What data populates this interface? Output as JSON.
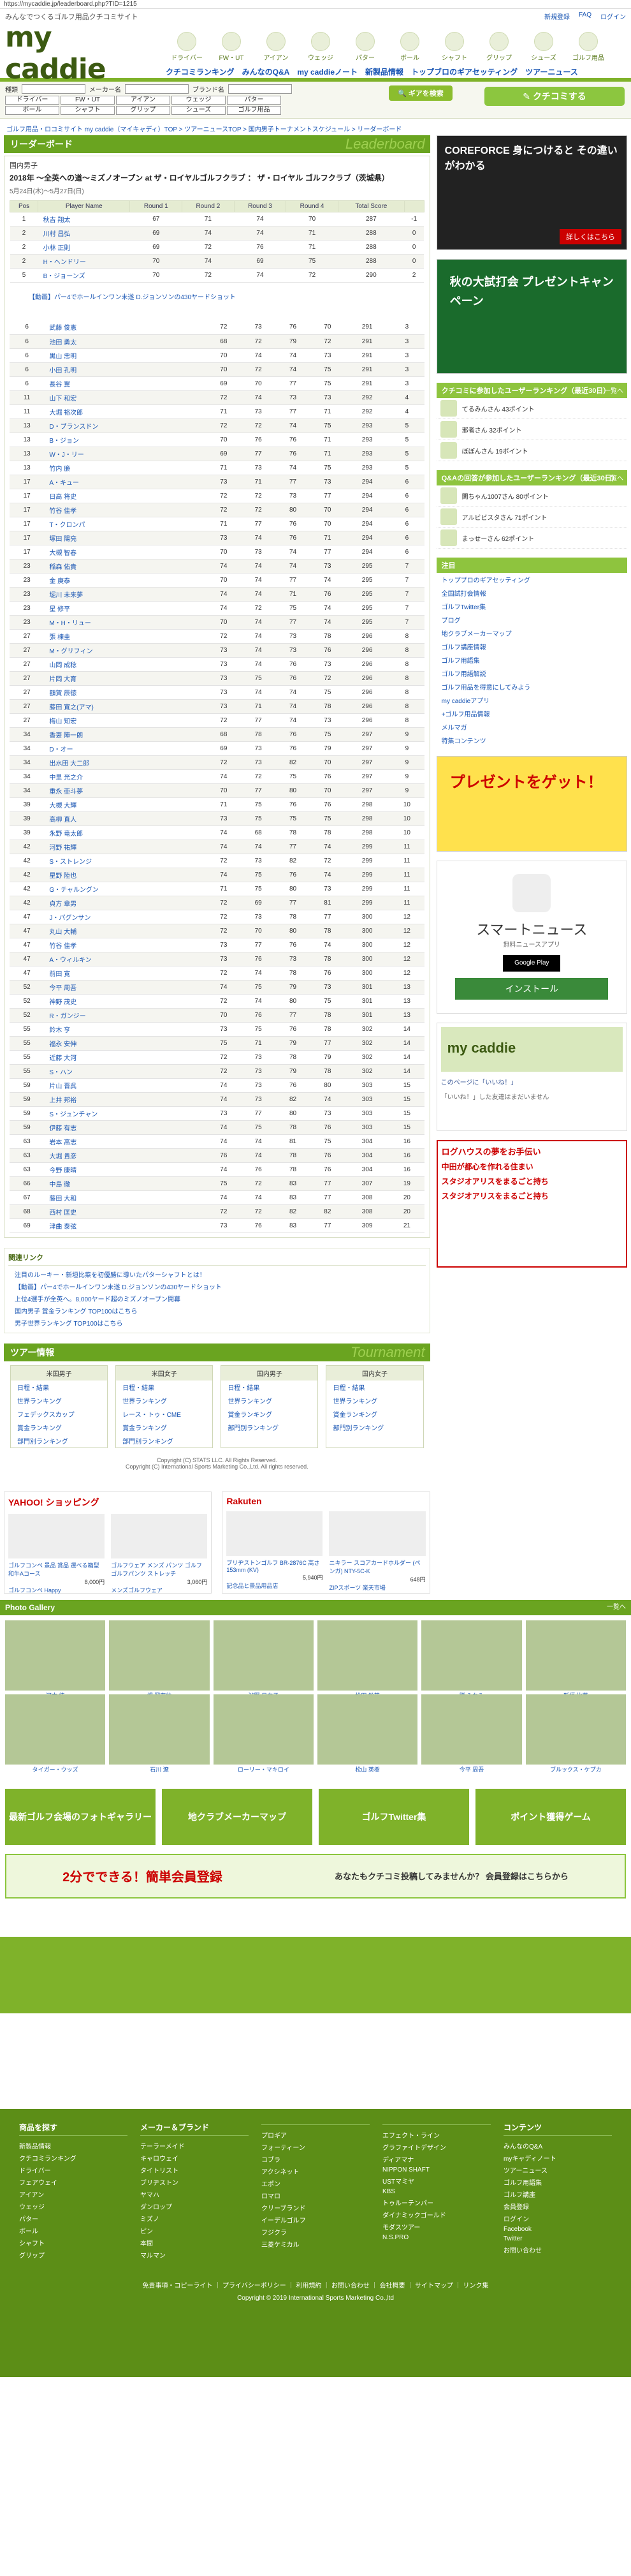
{
  "url": "https://mycaddie.jp/leaderboard.php?TID=1215",
  "header": {
    "tagline": "みんなでつくるゴルフ用品クチコミサイト",
    "logo": "my caddie",
    "toplinks": [
      "新規登録",
      "FAQ",
      "ログイン"
    ],
    "categories": [
      "ドライバー",
      "FW・UT",
      "アイアン",
      "ウェッジ",
      "パター",
      "ボール",
      "シャフト",
      "グリップ",
      "シューズ",
      "ゴルフ用品"
    ],
    "nav": [
      "クチコミランキング",
      "みんなのQ&A",
      "my caddieノート",
      "新製品情報",
      "トップブロのギアセッティング",
      "ツアーニュース"
    ]
  },
  "search": {
    "label_kind": "種類",
    "label_maker": "メーカー名",
    "label_brand": "ブランド名",
    "buttons": [
      "ドライバー",
      "FW・UT",
      "アイアン",
      "ウェッジ",
      "パター",
      "ボール",
      "シャフト",
      "グリップ",
      "シューズ",
      "ゴルフ用品"
    ],
    "gear_button": "ギアを検索",
    "kuchikomi": "クチコミする"
  },
  "breadcrumb": "ゴルフ用品・ロコミサイト my caddie（マイキャディ）TOP > ツアーニュースTOP > 国内男子トーナメントスケジュール > リーダーボード",
  "leaderboard": {
    "title": "リーダーボード",
    "title_en": "Leaderboard",
    "tour": "国内男子",
    "event": "2018年 ～全英への道～ミズノオープン at ザ・ロイヤルゴルフクラブ ： ザ・ロイヤル ゴルフクラブ（茨城県）",
    "date": "5月24日(木)～5月27日(日)",
    "columns": [
      "Pos",
      "Player Name",
      "Round 1",
      "Round 2",
      "Round 3",
      "Round 4",
      "Total Score",
      ""
    ],
    "top_rows": [
      [
        "1",
        "秋吉 翔太",
        "67",
        "71",
        "74",
        "70",
        "287",
        "-1"
      ],
      [
        "2",
        "川村 昌弘",
        "69",
        "74",
        "74",
        "71",
        "288",
        "0"
      ],
      [
        "2",
        "小林 正則",
        "69",
        "72",
        "76",
        "71",
        "288",
        "0"
      ],
      [
        "2",
        "H・ヘンドリー",
        "70",
        "74",
        "69",
        "75",
        "288",
        "0"
      ],
      [
        "5",
        "B・ジョーンズ",
        "70",
        "72",
        "74",
        "72",
        "290",
        "2"
      ]
    ],
    "note": "【動画】パー4でホールインワン未遂 D.ジョンソンの430ヤードショット",
    "rows": [
      [
        "6",
        "武藤 俊憲",
        "72",
        "73",
        "76",
        "70",
        "291",
        "3"
      ],
      [
        "6",
        "池田 勇太",
        "68",
        "72",
        "79",
        "72",
        "291",
        "3"
      ],
      [
        "6",
        "黒山 忠明",
        "70",
        "74",
        "74",
        "73",
        "291",
        "3"
      ],
      [
        "6",
        "小田 孔明",
        "70",
        "72",
        "74",
        "75",
        "291",
        "3"
      ],
      [
        "6",
        "長谷 翼",
        "69",
        "70",
        "77",
        "75",
        "291",
        "3"
      ],
      [
        "11",
        "山下 和宏",
        "72",
        "74",
        "73",
        "73",
        "292",
        "4"
      ],
      [
        "11",
        "大堀 裕次郎",
        "71",
        "73",
        "77",
        "71",
        "292",
        "4"
      ],
      [
        "13",
        "D・ブランスドン",
        "72",
        "72",
        "74",
        "75",
        "293",
        "5"
      ],
      [
        "13",
        "B・ジョン",
        "70",
        "76",
        "76",
        "71",
        "293",
        "5"
      ],
      [
        "13",
        "W・J・リー",
        "69",
        "77",
        "76",
        "71",
        "293",
        "5"
      ],
      [
        "13",
        "竹内 廉",
        "71",
        "73",
        "74",
        "75",
        "293",
        "5"
      ],
      [
        "17",
        "A・キュー",
        "73",
        "71",
        "77",
        "73",
        "294",
        "6"
      ],
      [
        "17",
        "日高 将史",
        "72",
        "72",
        "73",
        "77",
        "294",
        "6"
      ],
      [
        "17",
        "竹谷 佳孝",
        "72",
        "72",
        "80",
        "70",
        "294",
        "6"
      ],
      [
        "17",
        "T・クロンパ",
        "71",
        "77",
        "76",
        "70",
        "294",
        "6"
      ],
      [
        "17",
        "塚田 陽亮",
        "73",
        "74",
        "76",
        "71",
        "294",
        "6"
      ],
      [
        "17",
        "大槻 智春",
        "70",
        "73",
        "74",
        "77",
        "294",
        "6"
      ],
      [
        "23",
        "稲森 佑貴",
        "74",
        "74",
        "74",
        "73",
        "295",
        "7"
      ],
      [
        "23",
        "金 庚泰",
        "70",
        "74",
        "77",
        "74",
        "295",
        "7"
      ],
      [
        "23",
        "堀川 未来夢",
        "74",
        "74",
        "71",
        "76",
        "295",
        "7"
      ],
      [
        "23",
        "星 修平",
        "74",
        "72",
        "75",
        "74",
        "295",
        "7"
      ],
      [
        "23",
        "M・H・リュー",
        "70",
        "74",
        "77",
        "74",
        "295",
        "7"
      ],
      [
        "27",
        "張 棟圭",
        "72",
        "74",
        "73",
        "78",
        "296",
        "8"
      ],
      [
        "27",
        "M・グリフィン",
        "73",
        "74",
        "73",
        "76",
        "296",
        "8"
      ],
      [
        "27",
        "山岡 成稔",
        "73",
        "74",
        "76",
        "73",
        "296",
        "8"
      ],
      [
        "27",
        "片岡 大育",
        "73",
        "75",
        "76",
        "72",
        "296",
        "8"
      ],
      [
        "27",
        "額賀 辰徳",
        "73",
        "74",
        "74",
        "75",
        "296",
        "8"
      ],
      [
        "27",
        "藤田 寛之(アマ)",
        "73",
        "71",
        "74",
        "78",
        "296",
        "8"
      ],
      [
        "27",
        "梅山 知宏",
        "72",
        "77",
        "74",
        "73",
        "296",
        "8"
      ],
      [
        "34",
        "香妻 陣一朗",
        "68",
        "78",
        "76",
        "75",
        "297",
        "9"
      ],
      [
        "34",
        "D・オー",
        "69",
        "73",
        "76",
        "79",
        "297",
        "9"
      ],
      [
        "34",
        "出水田 大二郎",
        "72",
        "73",
        "82",
        "70",
        "297",
        "9"
      ],
      [
        "34",
        "中里 光之介",
        "74",
        "72",
        "75",
        "76",
        "297",
        "9"
      ],
      [
        "34",
        "重永 亜斗夢",
        "70",
        "77",
        "80",
        "70",
        "297",
        "9"
      ],
      [
        "39",
        "大槻 大輝",
        "71",
        "75",
        "76",
        "76",
        "298",
        "10"
      ],
      [
        "39",
        "高柳 直人",
        "73",
        "75",
        "75",
        "75",
        "298",
        "10"
      ],
      [
        "39",
        "永野 竜太郎",
        "74",
        "68",
        "78",
        "78",
        "298",
        "10"
      ],
      [
        "42",
        "河野 祐輝",
        "74",
        "74",
        "77",
        "74",
        "299",
        "11"
      ],
      [
        "42",
        "S・ストレンジ",
        "72",
        "73",
        "82",
        "72",
        "299",
        "11"
      ],
      [
        "42",
        "星野 陸也",
        "74",
        "75",
        "76",
        "74",
        "299",
        "11"
      ],
      [
        "42",
        "G・チャルングン",
        "71",
        "75",
        "80",
        "73",
        "299",
        "11"
      ],
      [
        "42",
        "貞方 章男",
        "72",
        "69",
        "77",
        "81",
        "299",
        "11"
      ],
      [
        "47",
        "J・パグンサン",
        "72",
        "73",
        "78",
        "77",
        "300",
        "12"
      ],
      [
        "47",
        "丸山 大輔",
        "72",
        "70",
        "80",
        "78",
        "300",
        "12"
      ],
      [
        "47",
        "竹谷 佳孝",
        "73",
        "77",
        "76",
        "74",
        "300",
        "12"
      ],
      [
        "47",
        "A・ウィルキン",
        "73",
        "76",
        "73",
        "78",
        "300",
        "12"
      ],
      [
        "47",
        "前田 寛",
        "72",
        "74",
        "78",
        "76",
        "300",
        "12"
      ],
      [
        "52",
        "今平 周吾",
        "74",
        "75",
        "79",
        "73",
        "301",
        "13"
      ],
      [
        "52",
        "神野 茂史",
        "72",
        "74",
        "80",
        "75",
        "301",
        "13"
      ],
      [
        "52",
        "R・ガンジー",
        "70",
        "76",
        "77",
        "78",
        "301",
        "13"
      ],
      [
        "55",
        "鈴木 亨",
        "73",
        "75",
        "76",
        "78",
        "302",
        "14"
      ],
      [
        "55",
        "福永 安伸",
        "75",
        "71",
        "79",
        "77",
        "302",
        "14"
      ],
      [
        "55",
        "近藤 大河",
        "72",
        "73",
        "78",
        "79",
        "302",
        "14"
      ],
      [
        "55",
        "S・ハン",
        "72",
        "73",
        "79",
        "78",
        "302",
        "14"
      ],
      [
        "59",
        "片山 晋呉",
        "74",
        "73",
        "76",
        "80",
        "303",
        "15"
      ],
      [
        "59",
        "上井 邦裕",
        "74",
        "73",
        "82",
        "74",
        "303",
        "15"
      ],
      [
        "59",
        "S・ジュンチャン",
        "73",
        "77",
        "80",
        "73",
        "303",
        "15"
      ],
      [
        "59",
        "伊藤 有志",
        "74",
        "75",
        "78",
        "76",
        "303",
        "15"
      ],
      [
        "63",
        "岩本 高志",
        "74",
        "74",
        "81",
        "75",
        "304",
        "16"
      ],
      [
        "63",
        "大堀 貴彦",
        "76",
        "74",
        "78",
        "76",
        "304",
        "16"
      ],
      [
        "63",
        "今野 康晴",
        "74",
        "76",
        "78",
        "76",
        "304",
        "16"
      ],
      [
        "66",
        "中島 徹",
        "75",
        "72",
        "83",
        "77",
        "307",
        "19"
      ],
      [
        "67",
        "藤田 大和",
        "74",
        "74",
        "83",
        "77",
        "308",
        "20"
      ],
      [
        "68",
        "西村 匡史",
        "72",
        "72",
        "82",
        "82",
        "308",
        "20"
      ],
      [
        "69",
        "津曲 泰弦",
        "73",
        "76",
        "83",
        "77",
        "309",
        "21"
      ]
    ]
  },
  "related": {
    "title": "関連リンク",
    "items": [
      "注目のルーキー・新垣比菜を初優勝に導いたパターシャフトとは！",
      "【動画】パー4でホールインワン未遂 D.ジョンソンの430ヤードショット",
      "上位4選手が全英へ。8,000ヤード超のミズノオープン開幕",
      "国内男子 賞金ランキング TOP100はこちら",
      "男子世界ランキング TOP100はこちら"
    ]
  },
  "tour_info": {
    "title": "ツアー情報",
    "title_en": "Tournament",
    "cols": [
      {
        "name": "米国男子",
        "items": [
          "日程・結果",
          "世界ランキング",
          "フェデックスカップ",
          "賞金ランキング",
          "部門別ランキング"
        ]
      },
      {
        "name": "米国女子",
        "items": [
          "日程・結果",
          "世界ランキング",
          "レース・トゥ・CME",
          "賞金ランキング",
          "部門別ランキング"
        ]
      },
      {
        "name": "国内男子",
        "items": [
          "日程・結果",
          "世界ランキング",
          "賞金ランキング",
          "部門別ランキング"
        ]
      },
      {
        "name": "国内女子",
        "items": [
          "日程・結果",
          "世界ランキング",
          "賞金ランキング",
          "部門別ランキング"
        ]
      }
    ],
    "copyright1": "Copyright (C) STATS LLC. All Rights Reserved.",
    "copyright2": "Copyright (C) International Sports Marketing Co.,Ltd. All rights reserved."
  },
  "shopping": {
    "yahoo": "YAHOO! ショッピング",
    "rakuten": "Rakuten",
    "yahoo_items": [
      {
        "name": "ゴルフコンペ 景品 賞品 選べる箱型和牛Aコース",
        "price": "8,000円",
        "shop": "ゴルフコンペ Happy"
      },
      {
        "name": "ゴルフウェア メンズ パンツ ゴルフ ゴルフパンツ ストレッチ",
        "price": "3,060円",
        "shop": "メンズゴルフウェア"
      }
    ],
    "rakuten_items": [
      {
        "name": "ブリヂストンゴルフ BR-2876C 高さ153mm (KV)",
        "price": "5,940円",
        "shop": "記念品と景品用品店"
      },
      {
        "name": "ニキラー スコアカードホルダー (ペンガ) NTY-5C-K",
        "price": "648円",
        "shop": "ZIPスポーツ 楽天市場"
      }
    ]
  },
  "gallery": {
    "title": "Photo Gallery",
    "more": "一覧へ",
    "captions": [
      "河本 結",
      "畑 岡奈紗",
      "渋野 日向子",
      "松田 鈴英",
      "勝 みなみ",
      "新垣 比菜",
      "タイガー・ウッズ",
      "石川 遼",
      "ローリー・マキロイ",
      "松山 英樹",
      "今平 周吾",
      "ブルックス・ケプカ"
    ]
  },
  "banners": [
    "最新ゴルフ会場のフォトギャラリー",
    "地クラブメーカーマップ",
    "ゴルフTwitter集",
    "ポイント獲得ゲーム"
  ],
  "register": {
    "left": "2分でできる！簡単会員登録",
    "right": "あなたもクチコミ投稿してみませんか？ 会員登録はこちらから"
  },
  "sidebar": {
    "ad1": "COREFORCE 身につけると その違いがわかる",
    "ad1_sub": "詳しくはこちら",
    "ad2": "秋の大試打会 プレゼントキャンペーン",
    "ranking_title": "クチコミに参加したユーザーランキング（最近30日）",
    "ranking_more": "一覧へ",
    "ranking_users": [
      [
        "てるみんさん",
        "43ポイント"
      ],
      [
        "邪者さん",
        "32ポイント"
      ],
      [
        "ぽぽんさん",
        "19ポイント"
      ]
    ],
    "qa_title": "Q&Aの回答が参加したユーザーランキング（最近30日）",
    "qa_users": [
      [
        "関ちゃん1007さん",
        "80ポイント"
      ],
      [
        "アルビビスタさん",
        "71ポイント"
      ],
      [
        "まっせーさん",
        "62ポイント"
      ]
    ],
    "chumoku_title": "注目",
    "chumoku": [
      "トッププロのギアセッティング",
      "全国試打会情報",
      "ゴルフTwitter集",
      "ブログ",
      "地クラブメーカーマップ",
      "ゴルフ講座情報",
      "ゴルフ用語集",
      "ゴルフ用語解説",
      "ゴルフ用品を得意にしてみよう",
      "my caddieアプリ",
      "+ゴルフ用品情報",
      "メルマガ",
      "特集コンテンツ"
    ],
    "present": "プレゼントをゲット！",
    "smartnews": "スマートニュース",
    "smartnews_sub": "無料ニュースアプリ",
    "googleplay": "Google Play",
    "install": "インストール",
    "fb_page": "my caddie",
    "fb_like": "このページに「いいね！」",
    "fb_note": "「いいね！」した友達はまだいません",
    "ad3_items": [
      "ログハウスの夢をお手伝い",
      "中田が都心を作れる住まい",
      "スタジオアリスをまるごと持ち",
      "スタジオアリスをまるごと持ち"
    ]
  },
  "footer": {
    "cols": [
      {
        "name": "商品を探す",
        "items": [
          "新製品情報",
          "クチコミランキング",
          "ドライバー",
          "フェアウェイ",
          "アイアン",
          "ウェッジ",
          "パター",
          "ボール",
          "シャフト",
          "グリップ"
        ]
      },
      {
        "name": "メーカー＆ブランド",
        "items": [
          "テーラーメイド",
          "キャロウェイ",
          "タイトリスト",
          "ブリヂストン",
          "ヤマハ",
          "ダンロップ",
          "ミズノ",
          "ピン",
          "本間",
          "マルマン"
        ]
      },
      {
        "name": "",
        "items": [
          "プロギア",
          "フォーティーン",
          "コブラ",
          "アクシネット",
          "エポン",
          "ロマロ",
          "クリーブランド",
          "イーデルゴルフ",
          "フジクラ",
          "三菱ケミカル"
        ]
      },
      {
        "name": "",
        "items": [
          "エフェクト・ライン",
          "グラファイトデザイン",
          "ディアマナ",
          "NIPPON SHAFT",
          "USTマミヤ",
          "KBS",
          "トゥルーテンパー",
          "ダイナミックゴールド",
          "モダスツアー",
          "N.S.PRO"
        ]
      },
      {
        "name": "コンテンツ",
        "items": [
          "みんなのQ&A",
          "myキャディノート",
          "ツアーニュース",
          "ゴルフ用語集",
          "ゴルフ講座",
          "会員登録",
          "ログイン",
          "Facebook",
          "Twitter",
          "お問い合わせ"
        ]
      }
    ],
    "bottom": "免責事項・コピーライト ｜ プライバシーポリシー ｜ 利用規約 ｜ お問い合わせ ｜ 会社概要 ｜ サイトマップ ｜ リンク集",
    "copyright": "Copyright © 2019 International Sports Marketing Co.,ltd"
  }
}
